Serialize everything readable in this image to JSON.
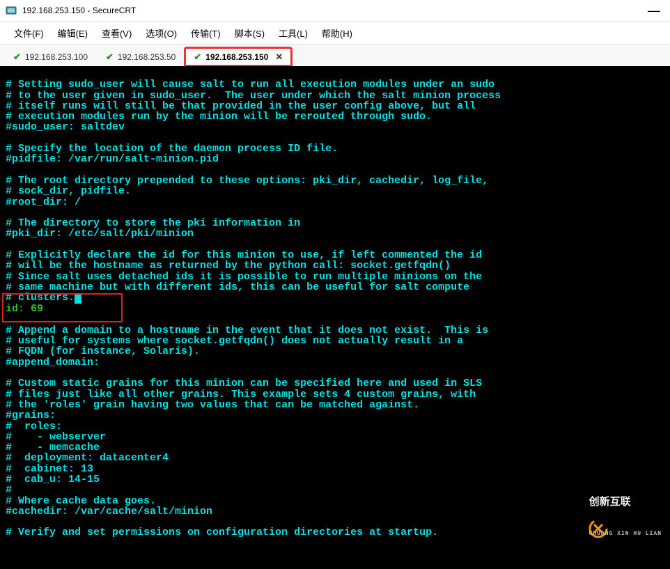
{
  "window": {
    "title": "192.168.253.150 - SecureCRT"
  },
  "menu": {
    "file": "文件(F)",
    "edit": "编辑(E)",
    "view": "查看(V)",
    "options": "选项(O)",
    "transfer": "传输(T)",
    "script": "脚本(S)",
    "tools": "工具(L)",
    "help": "帮助(H)"
  },
  "tabs": [
    {
      "label": "192.168.253.100"
    },
    {
      "label": "192.168.253.50"
    },
    {
      "label": "192.168.253.150",
      "active": true,
      "close": "✕"
    }
  ],
  "terminal": {
    "line01": "# Setting sudo_user will cause salt to run all execution modules under an sudo",
    "line02": "# to the user given in sudo_user.  The user under which the salt minion process",
    "line03": "# itself runs will still be that provided in the user config above, but all",
    "line04": "# execution modules run by the minion will be rerouted through sudo.",
    "line05": "#sudo_user: saltdev",
    "line06": "",
    "line07": "# Specify the location of the daemon process ID file.",
    "line08": "#pidfile: /var/run/salt-minion.pid",
    "line09": "",
    "line10": "# The root directory prepended to these options: pki_dir, cachedir, log_file,",
    "line11": "# sock_dir, pidfile.",
    "line12": "#root_dir: /",
    "line13": "",
    "line14": "# The directory to store the pki information in",
    "line15": "#pki_dir: /etc/salt/pki/minion",
    "line16": "",
    "line17": "# Explicitly declare the id for this minion to use, if left commented the id",
    "line18": "# will be the hostname as returned by the python call: socket.getfqdn()",
    "line19": "# Since salt uses detached ids it is possible to run multiple minions on the",
    "line20": "# same machine but with different ids, this can be useful for salt compute",
    "line21": "# clusters.",
    "line22": "id: 69",
    "line23": "",
    "line24": "# Append a domain to a hostname in the event that it does not exist.  This is",
    "line25": "# useful for systems where socket.getfqdn() does not actually result in a",
    "line26": "# FQDN (for instance, Solaris).",
    "line27": "#append_domain:",
    "line28": "",
    "line29": "# Custom static grains for this minion can be specified here and used in SLS",
    "line30": "# files just like all other grains. This example sets 4 custom grains, with",
    "line31": "# the 'roles' grain having two values that can be matched against.",
    "line32": "#grains:",
    "line33": "#  roles:",
    "line34": "#    - webserver",
    "line35": "#    - memcache",
    "line36": "#  deployment: datacenter4",
    "line37": "#  cabinet: 13",
    "line38": "#  cab_u: 14-15",
    "line39": "#",
    "line40": "# Where cache data goes.",
    "line41": "#cachedir: /var/cache/salt/minion",
    "line42": "",
    "line43": "# Verify and set permissions on configuration directories at startup."
  },
  "watermark": {
    "brand": "创新互联",
    "sub": "CHUANG XIN HU LIAN"
  }
}
